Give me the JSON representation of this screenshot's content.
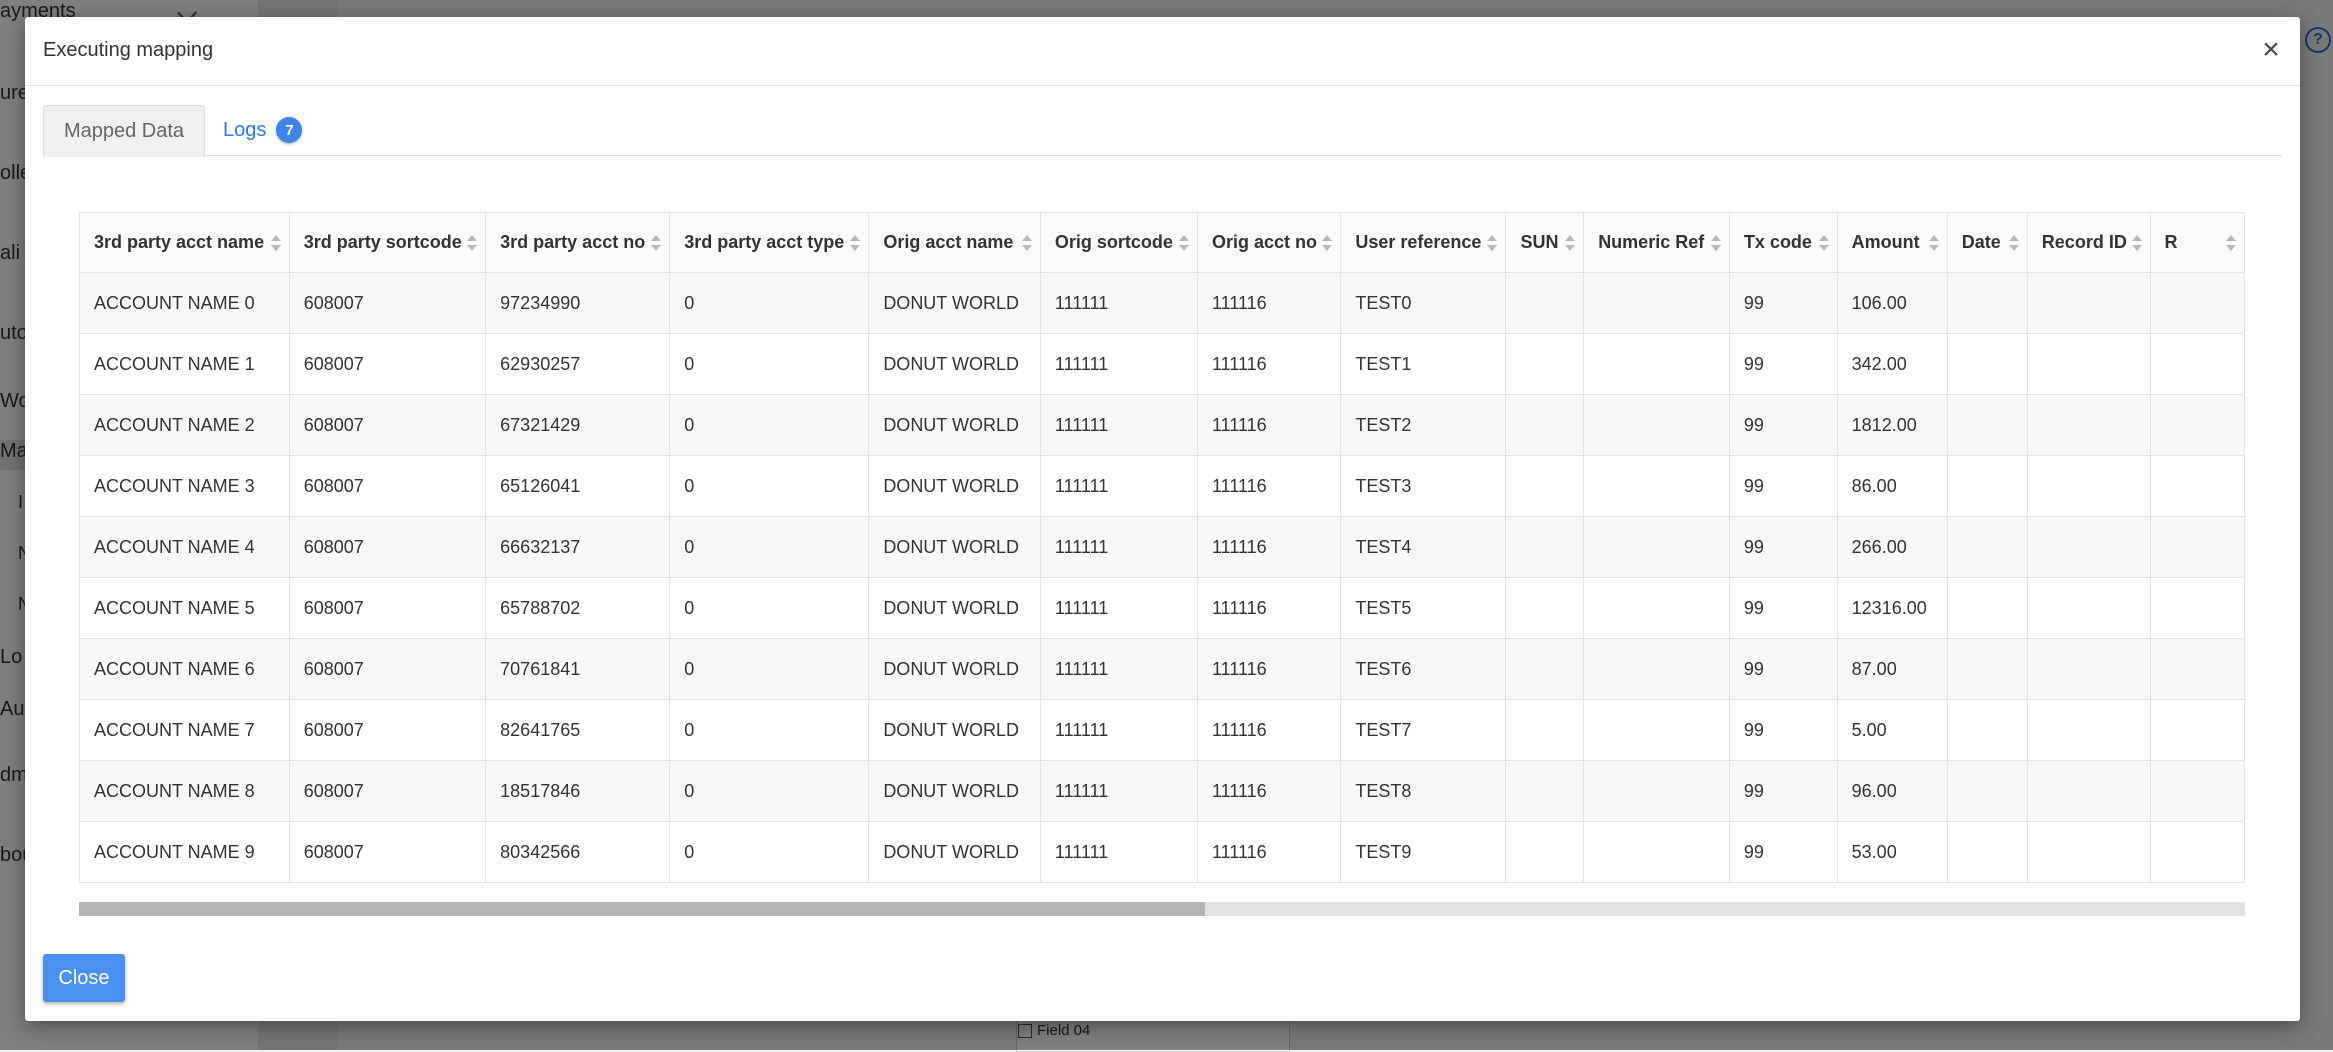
{
  "background": {
    "sidebar_items": [
      {
        "label": "ayments"
      },
      {
        "label": "ure"
      },
      {
        "label": "olle"
      },
      {
        "label": "ali"
      },
      {
        "label": "uto"
      },
      {
        "label": "Wo"
      },
      {
        "label": "Ma"
      },
      {
        "label": "I"
      },
      {
        "label": "N"
      },
      {
        "label": "N"
      },
      {
        "label": "Lo"
      },
      {
        "label": "Au"
      },
      {
        "label": "dm"
      },
      {
        "label": "bou"
      }
    ],
    "field_label": "Field 04",
    "help_glyph": "?"
  },
  "modal": {
    "title": "Executing mapping",
    "close_glyph": "×",
    "tabs": {
      "mapped": "Mapped Data",
      "logs": "Logs",
      "logs_count": "7"
    },
    "close_button": "Close"
  },
  "table": {
    "columns": [
      "3rd party acct name",
      "3rd party sortcode",
      "3rd party acct no",
      "3rd party acct type",
      "Orig acct name",
      "Orig sortcode",
      "Orig acct no",
      "User reference",
      "SUN",
      "Numeric Ref",
      "Tx code",
      "Amount",
      "Date",
      "Record ID",
      "R"
    ],
    "rows": [
      [
        "ACCOUNT NAME 0",
        "608007",
        "97234990",
        "0",
        "DONUT WORLD",
        "111111",
        "111116",
        "TEST0",
        "",
        "",
        "99",
        "106.00",
        "",
        "",
        ""
      ],
      [
        "ACCOUNT NAME 1",
        "608007",
        "62930257",
        "0",
        "DONUT WORLD",
        "111111",
        "111116",
        "TEST1",
        "",
        "",
        "99",
        "342.00",
        "",
        "",
        ""
      ],
      [
        "ACCOUNT NAME 2",
        "608007",
        "67321429",
        "0",
        "DONUT WORLD",
        "111111",
        "111116",
        "TEST2",
        "",
        "",
        "99",
        "1812.00",
        "",
        "",
        ""
      ],
      [
        "ACCOUNT NAME 3",
        "608007",
        "65126041",
        "0",
        "DONUT WORLD",
        "111111",
        "111116",
        "TEST3",
        "",
        "",
        "99",
        "86.00",
        "",
        "",
        ""
      ],
      [
        "ACCOUNT NAME 4",
        "608007",
        "66632137",
        "0",
        "DONUT WORLD",
        "111111",
        "111116",
        "TEST4",
        "",
        "",
        "99",
        "266.00",
        "",
        "",
        ""
      ],
      [
        "ACCOUNT NAME 5",
        "608007",
        "65788702",
        "0",
        "DONUT WORLD",
        "111111",
        "111116",
        "TEST5",
        "",
        "",
        "99",
        "12316.00",
        "",
        "",
        ""
      ],
      [
        "ACCOUNT NAME 6",
        "608007",
        "70761841",
        "0",
        "DONUT WORLD",
        "111111",
        "111116",
        "TEST6",
        "",
        "",
        "99",
        "87.00",
        "",
        "",
        ""
      ],
      [
        "ACCOUNT NAME 7",
        "608007",
        "82641765",
        "0",
        "DONUT WORLD",
        "111111",
        "111116",
        "TEST7",
        "",
        "",
        "99",
        "5.00",
        "",
        "",
        ""
      ],
      [
        "ACCOUNT NAME 8",
        "608007",
        "18517846",
        "0",
        "DONUT WORLD",
        "111111",
        "111116",
        "TEST8",
        "",
        "",
        "99",
        "96.00",
        "",
        "",
        ""
      ],
      [
        "ACCOUNT NAME 9",
        "608007",
        "80342566",
        "0",
        "DONUT WORLD",
        "111111",
        "111116",
        "TEST9",
        "",
        "",
        "99",
        "53.00",
        "",
        "",
        ""
      ]
    ]
  },
  "colors": {
    "accent": "#4a90f0",
    "link": "#2a7ae2",
    "badge": "#3d85e8"
  }
}
